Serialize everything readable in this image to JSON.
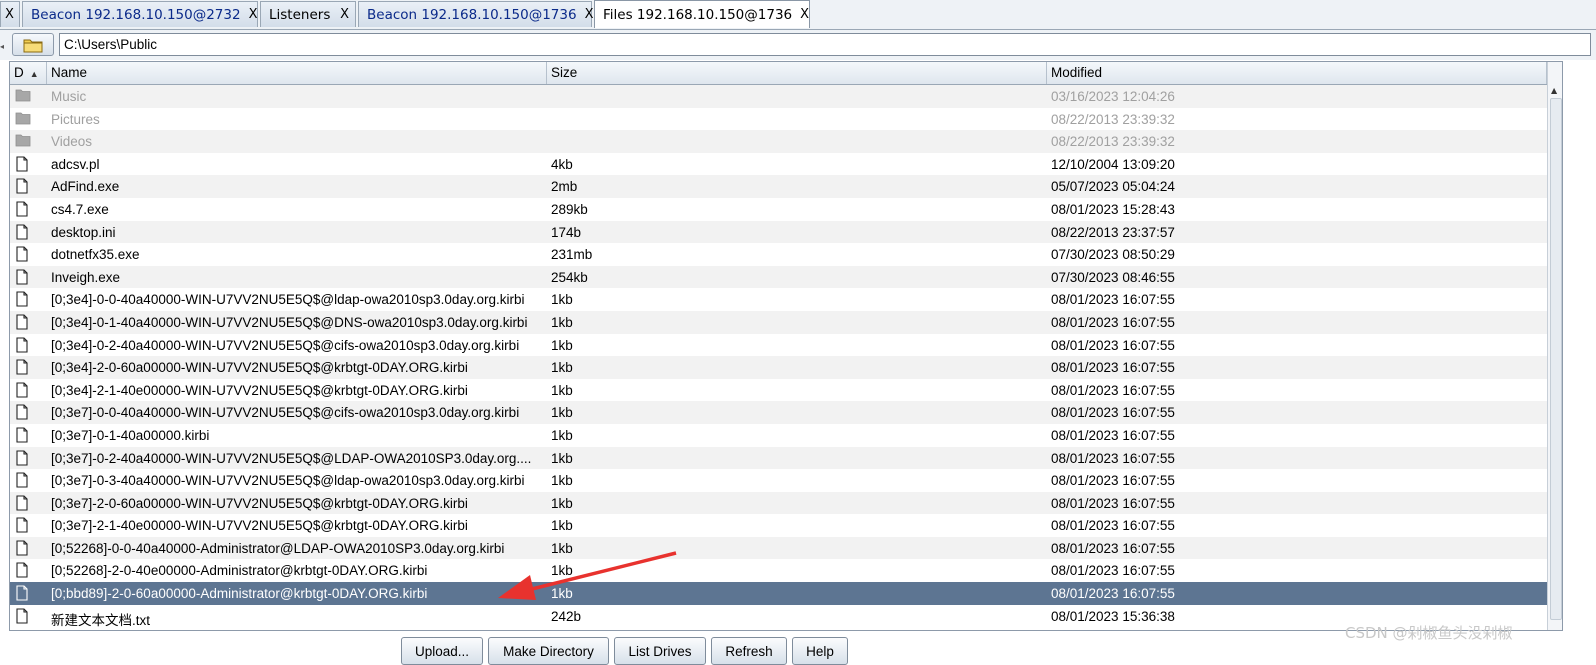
{
  "tabs": [
    {
      "label": "",
      "close": "X"
    },
    {
      "label": "Beacon 192.168.10.150@2732",
      "close": "X"
    },
    {
      "label": "Listeners",
      "close": "X"
    },
    {
      "label": "Beacon 192.168.10.150@1736",
      "close": "X"
    },
    {
      "label": "Files 192.168.10.150@1736",
      "close": "X"
    }
  ],
  "path": {
    "value": "C:\\Users\\Public"
  },
  "columns": {
    "d": "D",
    "name": "Name",
    "size": "Size",
    "modified": "Modified"
  },
  "rows": [
    {
      "type": "folder",
      "name": "Music",
      "size": "",
      "modified": "03/16/2023 12:04:26"
    },
    {
      "type": "folder",
      "name": "Pictures",
      "size": "",
      "modified": "08/22/2013 23:39:32"
    },
    {
      "type": "folder",
      "name": "Videos",
      "size": "",
      "modified": "08/22/2013 23:39:32"
    },
    {
      "type": "file",
      "name": "adcsv.pl",
      "size": "4kb",
      "modified": "12/10/2004 13:09:20"
    },
    {
      "type": "file",
      "name": "AdFind.exe",
      "size": "2mb",
      "modified": "05/07/2023 05:04:24"
    },
    {
      "type": "file",
      "name": "cs4.7.exe",
      "size": "289kb",
      "modified": "08/01/2023 15:28:43"
    },
    {
      "type": "file",
      "name": "desktop.ini",
      "size": "174b",
      "modified": "08/22/2013 23:37:57"
    },
    {
      "type": "file",
      "name": "dotnetfx35.exe",
      "size": "231mb",
      "modified": "07/30/2023 08:50:29"
    },
    {
      "type": "file",
      "name": "Inveigh.exe",
      "size": "254kb",
      "modified": "07/30/2023 08:46:55"
    },
    {
      "type": "file",
      "name": "[0;3e4]-0-0-40a40000-WIN-U7VV2NU5E5Q$@ldap-owa2010sp3.0day.org.kirbi",
      "size": "1kb",
      "modified": "08/01/2023 16:07:55"
    },
    {
      "type": "file",
      "name": "[0;3e4]-0-1-40a40000-WIN-U7VV2NU5E5Q$@DNS-owa2010sp3.0day.org.kirbi",
      "size": "1kb",
      "modified": "08/01/2023 16:07:55"
    },
    {
      "type": "file",
      "name": "[0;3e4]-0-2-40a40000-WIN-U7VV2NU5E5Q$@cifs-owa2010sp3.0day.org.kirbi",
      "size": "1kb",
      "modified": "08/01/2023 16:07:55"
    },
    {
      "type": "file",
      "name": "[0;3e4]-2-0-60a00000-WIN-U7VV2NU5E5Q$@krbtgt-0DAY.ORG.kirbi",
      "size": "1kb",
      "modified": "08/01/2023 16:07:55"
    },
    {
      "type": "file",
      "name": "[0;3e4]-2-1-40e00000-WIN-U7VV2NU5E5Q$@krbtgt-0DAY.ORG.kirbi",
      "size": "1kb",
      "modified": "08/01/2023 16:07:55"
    },
    {
      "type": "file",
      "name": "[0;3e7]-0-0-40a40000-WIN-U7VV2NU5E5Q$@cifs-owa2010sp3.0day.org.kirbi",
      "size": "1kb",
      "modified": "08/01/2023 16:07:55"
    },
    {
      "type": "file",
      "name": "[0;3e7]-0-1-40a00000.kirbi",
      "size": "1kb",
      "modified": "08/01/2023 16:07:55"
    },
    {
      "type": "file",
      "name": "[0;3e7]-0-2-40a40000-WIN-U7VV2NU5E5Q$@LDAP-OWA2010SP3.0day.org....",
      "size": "1kb",
      "modified": "08/01/2023 16:07:55"
    },
    {
      "type": "file",
      "name": "[0;3e7]-0-3-40a40000-WIN-U7VV2NU5E5Q$@ldap-owa2010sp3.0day.org.kirbi",
      "size": "1kb",
      "modified": "08/01/2023 16:07:55"
    },
    {
      "type": "file",
      "name": "[0;3e7]-2-0-60a00000-WIN-U7VV2NU5E5Q$@krbtgt-0DAY.ORG.kirbi",
      "size": "1kb",
      "modified": "08/01/2023 16:07:55"
    },
    {
      "type": "file",
      "name": "[0;3e7]-2-1-40e00000-WIN-U7VV2NU5E5Q$@krbtgt-0DAY.ORG.kirbi",
      "size": "1kb",
      "modified": "08/01/2023 16:07:55"
    },
    {
      "type": "file",
      "name": "[0;52268]-0-0-40a40000-Administrator@LDAP-OWA2010SP3.0day.org.kirbi",
      "size": "1kb",
      "modified": "08/01/2023 16:07:55"
    },
    {
      "type": "file",
      "name": "[0;52268]-2-0-40e00000-Administrator@krbtgt-0DAY.ORG.kirbi",
      "size": "1kb",
      "modified": "08/01/2023 16:07:55"
    },
    {
      "type": "file",
      "name": "[0;bbd89]-2-0-60a00000-Administrator@krbtgt-0DAY.ORG.kirbi",
      "size": "1kb",
      "modified": "08/01/2023 16:07:55",
      "selected": true
    },
    {
      "type": "file",
      "name": "新建文本文档.txt",
      "size": "242b",
      "modified": "08/01/2023 15:36:38"
    }
  ],
  "buttons": {
    "upload": "Upload...",
    "make_directory": "Make Directory",
    "list_drives": "List Drives",
    "refresh": "Refresh",
    "help": "Help"
  },
  "watermark": "CSDN @剁椒鱼头没剁椒",
  "colors": {
    "selection": "#5d7592",
    "annotation_arrow": "#e8322e",
    "tab_link": "#0b2a8a"
  }
}
